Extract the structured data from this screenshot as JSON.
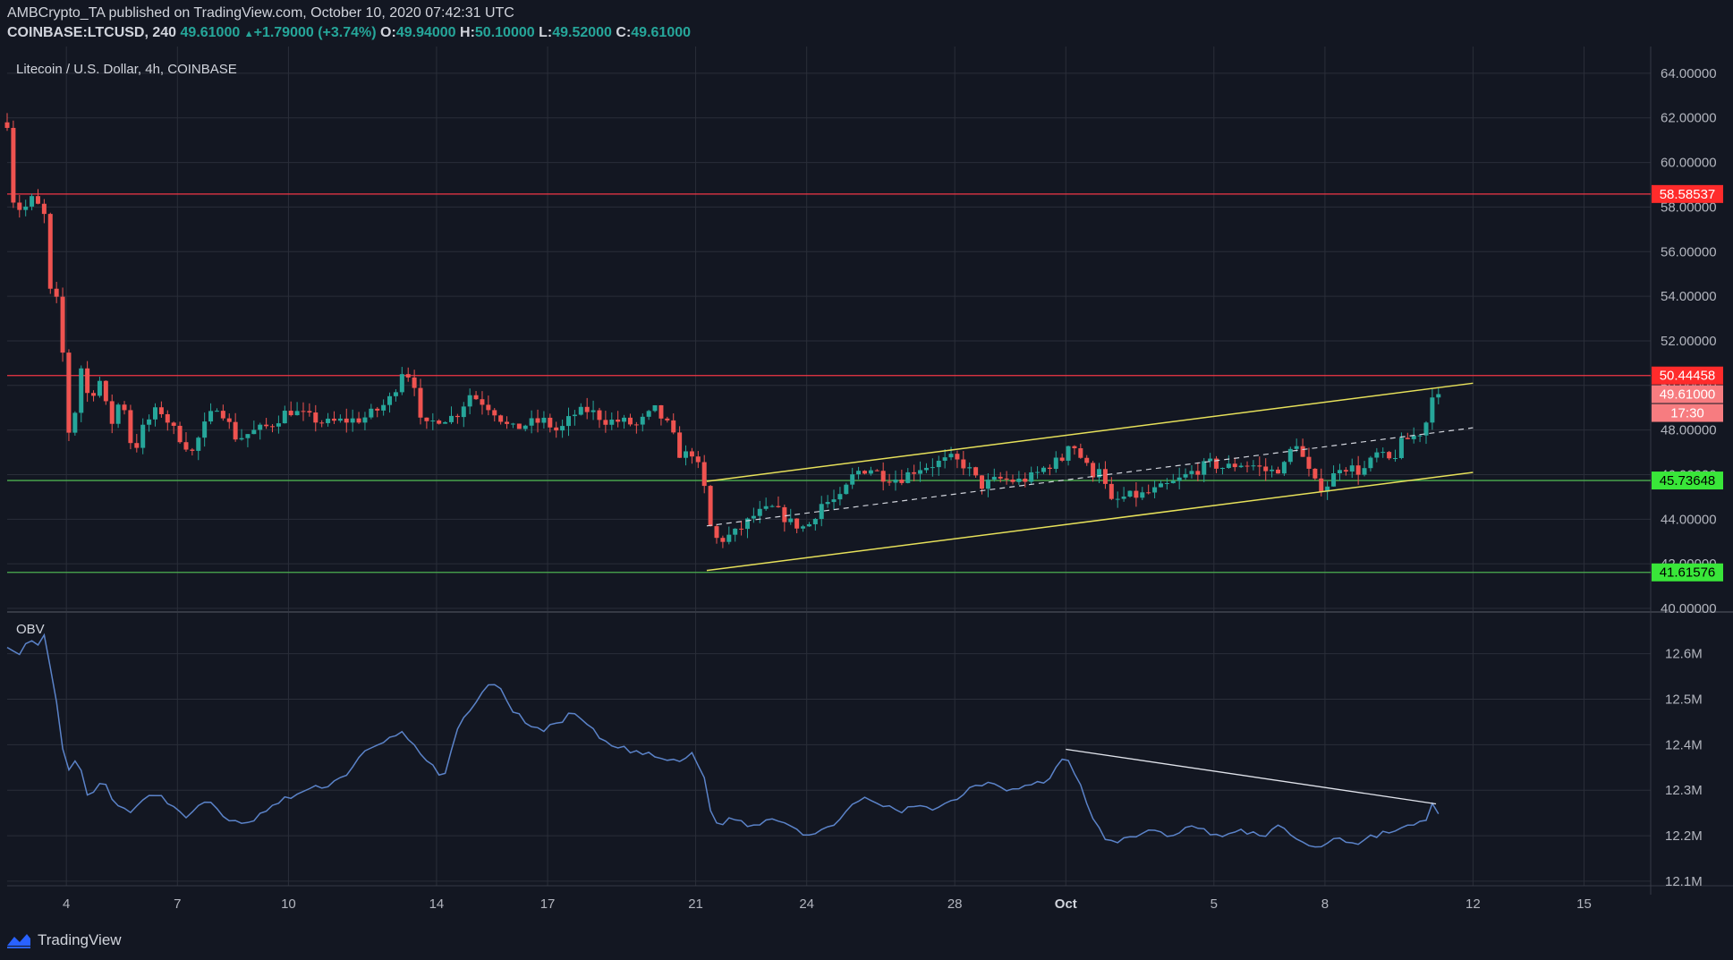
{
  "header": {
    "publisher": "AMBCrypto_TA",
    "published_text": "published on TradingView.com, October 10, 2020 07:42:31 UTC",
    "symbol": "COINBASE:LTCUSD, 240",
    "last": "49.61000",
    "change": "+1.79000 (+3.74%)",
    "o_label": "O:",
    "o_value": "49.94000",
    "h_label": "H:",
    "h_value": "50.10000",
    "l_label": "L:",
    "l_value": "49.52000",
    "c_label": "C:",
    "c_value": "49.61000"
  },
  "pane_title": "Litecoin / U.S. Dollar, 4h, COINBASE",
  "footer": {
    "brand": "TradingView"
  },
  "colors": {
    "bg": "#131722",
    "up": "#26a69a",
    "down": "#ef5350",
    "grid": "#2a2e39",
    "resistance": "#f23645",
    "support": "#4caf50",
    "channel": "#e6e05a",
    "obv": "#5b83c9",
    "text": "#b2b5be",
    "trendline": "#e0e3eb"
  },
  "chart_data": [
    {
      "type": "candlestick",
      "title": "Litecoin / U.S. Dollar, 4h, COINBASE",
      "ylim": [
        39.8,
        65.2
      ],
      "y_ticks": [
        "40.00000",
        "42.00000",
        "44.00000",
        "46.00000",
        "48.00000",
        "50.00000",
        "52.00000",
        "54.00000",
        "56.00000",
        "58.00000",
        "60.00000",
        "62.00000",
        "64.00000"
      ],
      "x_ticks": [
        "4",
        "7",
        "10",
        "14",
        "17",
        "21",
        "24",
        "28",
        "Oct",
        "5",
        "8",
        "12",
        "15"
      ],
      "x_tick_days": [
        4,
        7,
        10,
        14,
        17,
        21,
        24,
        28,
        31,
        35,
        38,
        42,
        45
      ],
      "x_range_days": [
        2.4,
        46.8
      ],
      "anchors": [
        {
          "d": 2.4,
          "p": 61.8
        },
        {
          "d": 2.5,
          "p": 58.5
        },
        {
          "d": 2.8,
          "p": 57.8
        },
        {
          "d": 3.1,
          "p": 58.4
        },
        {
          "d": 3.4,
          "p": 57.6
        },
        {
          "d": 3.6,
          "p": 53.5
        },
        {
          "d": 3.8,
          "p": 53.9
        },
        {
          "d": 3.95,
          "p": 50.2
        },
        {
          "d": 4.1,
          "p": 47.3
        },
        {
          "d": 4.4,
          "p": 50.8
        },
        {
          "d": 4.6,
          "p": 49.4
        },
        {
          "d": 4.9,
          "p": 50.2
        },
        {
          "d": 5.2,
          "p": 48.2
        },
        {
          "d": 5.5,
          "p": 49.6
        },
        {
          "d": 5.8,
          "p": 46.9
        },
        {
          "d": 6.1,
          "p": 48.2
        },
        {
          "d": 6.5,
          "p": 49.0
        },
        {
          "d": 6.9,
          "p": 48.0
        },
        {
          "d": 7.4,
          "p": 47.0
        },
        {
          "d": 7.7,
          "p": 48.1
        },
        {
          "d": 8.1,
          "p": 49.2
        },
        {
          "d": 8.6,
          "p": 47.6
        },
        {
          "d": 9.0,
          "p": 47.9
        },
        {
          "d": 9.5,
          "p": 48.2
        },
        {
          "d": 10.0,
          "p": 48.9
        },
        {
          "d": 10.5,
          "p": 48.6
        },
        {
          "d": 11.0,
          "p": 48.3
        },
        {
          "d": 11.4,
          "p": 48.4
        },
        {
          "d": 12.0,
          "p": 48.5
        },
        {
          "d": 12.5,
          "p": 49.0
        },
        {
          "d": 12.8,
          "p": 49.5
        },
        {
          "d": 13.1,
          "p": 50.8
        },
        {
          "d": 13.4,
          "p": 50.1
        },
        {
          "d": 13.6,
          "p": 48.0
        },
        {
          "d": 14.0,
          "p": 48.5
        },
        {
          "d": 14.5,
          "p": 48.6
        },
        {
          "d": 14.9,
          "p": 49.6
        },
        {
          "d": 15.3,
          "p": 49.2
        },
        {
          "d": 15.6,
          "p": 48.8
        },
        {
          "d": 16.0,
          "p": 48.0
        },
        {
          "d": 16.5,
          "p": 48.3
        },
        {
          "d": 16.9,
          "p": 48.4
        },
        {
          "d": 17.3,
          "p": 47.9
        },
        {
          "d": 17.7,
          "p": 48.7
        },
        {
          "d": 18.1,
          "p": 48.9
        },
        {
          "d": 18.6,
          "p": 48.4
        },
        {
          "d": 19.0,
          "p": 48.4
        },
        {
          "d": 19.4,
          "p": 48.2
        },
        {
          "d": 19.9,
          "p": 48.9
        },
        {
          "d": 20.3,
          "p": 48.1
        },
        {
          "d": 20.6,
          "p": 46.8
        },
        {
          "d": 20.9,
          "p": 47.0
        },
        {
          "d": 21.2,
          "p": 45.8
        },
        {
          "d": 21.35,
          "p": 43.8
        },
        {
          "d": 21.6,
          "p": 43.0
        },
        {
          "d": 22.1,
          "p": 43.4
        },
        {
          "d": 22.6,
          "p": 44.2
        },
        {
          "d": 23.1,
          "p": 44.5
        },
        {
          "d": 23.6,
          "p": 43.8
        },
        {
          "d": 24.0,
          "p": 43.6
        },
        {
          "d": 24.4,
          "p": 44.7
        },
        {
          "d": 24.9,
          "p": 44.9
        },
        {
          "d": 25.3,
          "p": 46.1
        },
        {
          "d": 25.7,
          "p": 46.3
        },
        {
          "d": 26.1,
          "p": 45.9
        },
        {
          "d": 26.5,
          "p": 45.8
        },
        {
          "d": 27.0,
          "p": 46.3
        },
        {
          "d": 27.5,
          "p": 46.5
        },
        {
          "d": 27.9,
          "p": 46.7
        },
        {
          "d": 28.3,
          "p": 46.4
        },
        {
          "d": 28.7,
          "p": 45.5
        },
        {
          "d": 29.2,
          "p": 45.8
        },
        {
          "d": 29.7,
          "p": 45.7
        },
        {
          "d": 30.1,
          "p": 45.9
        },
        {
          "d": 30.5,
          "p": 46.4
        },
        {
          "d": 30.9,
          "p": 46.7
        },
        {
          "d": 31.1,
          "p": 47.6
        },
        {
          "d": 31.4,
          "p": 46.8
        },
        {
          "d": 31.7,
          "p": 46.0
        },
        {
          "d": 31.9,
          "p": 46.4
        },
        {
          "d": 32.2,
          "p": 44.7
        },
        {
          "d": 32.6,
          "p": 45.0
        },
        {
          "d": 33.1,
          "p": 45.1
        },
        {
          "d": 33.6,
          "p": 45.4
        },
        {
          "d": 34.0,
          "p": 45.7
        },
        {
          "d": 34.4,
          "p": 46.1
        },
        {
          "d": 34.9,
          "p": 46.5
        },
        {
          "d": 35.3,
          "p": 46.3
        },
        {
          "d": 35.7,
          "p": 46.5
        },
        {
          "d": 36.1,
          "p": 46.4
        },
        {
          "d": 36.5,
          "p": 46.1
        },
        {
          "d": 36.9,
          "p": 46.4
        },
        {
          "d": 37.2,
          "p": 47.6
        },
        {
          "d": 37.5,
          "p": 46.3
        },
        {
          "d": 37.8,
          "p": 45.4
        },
        {
          "d": 38.1,
          "p": 45.6
        },
        {
          "d": 38.4,
          "p": 46.4
        },
        {
          "d": 38.7,
          "p": 46.3
        },
        {
          "d": 39.0,
          "p": 46.1
        },
        {
          "d": 39.4,
          "p": 46.9
        },
        {
          "d": 39.8,
          "p": 46.6
        },
        {
          "d": 40.1,
          "p": 47.5
        },
        {
          "d": 40.5,
          "p": 47.8
        },
        {
          "d": 40.7,
          "p": 48.1
        },
        {
          "d": 40.9,
          "p": 49.7
        },
        {
          "d": 41.1,
          "p": 49.61
        }
      ],
      "horizontal_levels": [
        {
          "value": 58.58537,
          "label": "58.58537",
          "kind": "resistance"
        },
        {
          "value": 50.44458,
          "label": "50.44458",
          "kind": "resistance"
        },
        {
          "value": 45.73648,
          "label": "45.73648",
          "kind": "support"
        },
        {
          "value": 41.61576,
          "label": "41.61576",
          "kind": "support"
        }
      ],
      "last_price_label": "49.61000",
      "countdown_label": "17:30",
      "channel": {
        "upper": [
          {
            "d": 21.3,
            "p": 45.7
          },
          {
            "d": 42.0,
            "p": 50.1
          }
        ],
        "lower": [
          {
            "d": 21.3,
            "p": 41.7
          },
          {
            "d": 42.0,
            "p": 46.1
          }
        ],
        "middle": [
          {
            "d": 21.3,
            "p": 43.7
          },
          {
            "d": 42.0,
            "p": 48.1
          }
        ]
      }
    },
    {
      "type": "line",
      "title": "OBV",
      "ylim": [
        12.09,
        12.68
      ],
      "y_ticks": [
        "12.1M",
        "12.2M",
        "12.3M",
        "12.4M",
        "12.5M",
        "12.6M"
      ],
      "anchors": [
        {
          "d": 2.4,
          "v": 12.62
        },
        {
          "d": 2.7,
          "v": 12.59
        },
        {
          "d": 3.0,
          "v": 12.63
        },
        {
          "d": 3.2,
          "v": 12.61
        },
        {
          "d": 3.4,
          "v": 12.64
        },
        {
          "d": 3.6,
          "v": 12.55
        },
        {
          "d": 3.8,
          "v": 12.46
        },
        {
          "d": 4.0,
          "v": 12.33
        },
        {
          "d": 4.3,
          "v": 12.37
        },
        {
          "d": 4.6,
          "v": 12.28
        },
        {
          "d": 5.0,
          "v": 12.32
        },
        {
          "d": 5.4,
          "v": 12.26
        },
        {
          "d": 5.8,
          "v": 12.25
        },
        {
          "d": 6.3,
          "v": 12.3
        },
        {
          "d": 6.8,
          "v": 12.27
        },
        {
          "d": 7.3,
          "v": 12.24
        },
        {
          "d": 7.8,
          "v": 12.28
        },
        {
          "d": 8.3,
          "v": 12.24
        },
        {
          "d": 8.8,
          "v": 12.22
        },
        {
          "d": 9.3,
          "v": 12.25
        },
        {
          "d": 9.9,
          "v": 12.28
        },
        {
          "d": 10.5,
          "v": 12.3
        },
        {
          "d": 11.0,
          "v": 12.31
        },
        {
          "d": 11.5,
          "v": 12.33
        },
        {
          "d": 12.0,
          "v": 12.38
        },
        {
          "d": 12.5,
          "v": 12.4
        },
        {
          "d": 13.0,
          "v": 12.43
        },
        {
          "d": 13.4,
          "v": 12.4
        },
        {
          "d": 13.8,
          "v": 12.36
        },
        {
          "d": 14.2,
          "v": 12.32
        },
        {
          "d": 14.5,
          "v": 12.42
        },
        {
          "d": 14.9,
          "v": 12.48
        },
        {
          "d": 15.3,
          "v": 12.52
        },
        {
          "d": 15.6,
          "v": 12.54
        },
        {
          "d": 16.0,
          "v": 12.48
        },
        {
          "d": 16.4,
          "v": 12.45
        },
        {
          "d": 16.9,
          "v": 12.43
        },
        {
          "d": 17.3,
          "v": 12.45
        },
        {
          "d": 17.7,
          "v": 12.47
        },
        {
          "d": 18.1,
          "v": 12.44
        },
        {
          "d": 18.6,
          "v": 12.4
        },
        {
          "d": 19.1,
          "v": 12.39
        },
        {
          "d": 19.6,
          "v": 12.38
        },
        {
          "d": 20.1,
          "v": 12.37
        },
        {
          "d": 20.5,
          "v": 12.36
        },
        {
          "d": 20.9,
          "v": 12.38
        },
        {
          "d": 21.2,
          "v": 12.34
        },
        {
          "d": 21.5,
          "v": 12.22
        },
        {
          "d": 22.0,
          "v": 12.24
        },
        {
          "d": 22.5,
          "v": 12.22
        },
        {
          "d": 23.0,
          "v": 12.24
        },
        {
          "d": 23.5,
          "v": 12.23
        },
        {
          "d": 24.0,
          "v": 12.2
        },
        {
          "d": 24.5,
          "v": 12.21
        },
        {
          "d": 25.0,
          "v": 12.25
        },
        {
          "d": 25.5,
          "v": 12.28
        },
        {
          "d": 26.0,
          "v": 12.27
        },
        {
          "d": 26.5,
          "v": 12.25
        },
        {
          "d": 27.0,
          "v": 12.27
        },
        {
          "d": 27.5,
          "v": 12.26
        },
        {
          "d": 28.0,
          "v": 12.28
        },
        {
          "d": 28.5,
          "v": 12.31
        },
        {
          "d": 29.0,
          "v": 12.32
        },
        {
          "d": 29.5,
          "v": 12.3
        },
        {
          "d": 30.0,
          "v": 12.31
        },
        {
          "d": 30.5,
          "v": 12.32
        },
        {
          "d": 31.0,
          "v": 12.38
        },
        {
          "d": 31.3,
          "v": 12.33
        },
        {
          "d": 31.6,
          "v": 12.26
        },
        {
          "d": 32.0,
          "v": 12.2
        },
        {
          "d": 32.3,
          "v": 12.18
        },
        {
          "d": 32.8,
          "v": 12.2
        },
        {
          "d": 33.3,
          "v": 12.21
        },
        {
          "d": 33.8,
          "v": 12.2
        },
        {
          "d": 34.3,
          "v": 12.22
        },
        {
          "d": 34.8,
          "v": 12.21
        },
        {
          "d": 35.3,
          "v": 12.2
        },
        {
          "d": 35.8,
          "v": 12.21
        },
        {
          "d": 36.3,
          "v": 12.2
        },
        {
          "d": 36.8,
          "v": 12.22
        },
        {
          "d": 37.3,
          "v": 12.19
        },
        {
          "d": 37.8,
          "v": 12.17
        },
        {
          "d": 38.3,
          "v": 12.2
        },
        {
          "d": 38.8,
          "v": 12.18
        },
        {
          "d": 39.3,
          "v": 12.2
        },
        {
          "d": 39.8,
          "v": 12.21
        },
        {
          "d": 40.3,
          "v": 12.22
        },
        {
          "d": 40.7,
          "v": 12.23
        },
        {
          "d": 40.9,
          "v": 12.27
        },
        {
          "d": 41.1,
          "v": 12.25
        }
      ],
      "trendline": [
        {
          "d": 31.0,
          "v": 12.39
        },
        {
          "d": 41.0,
          "v": 12.27
        }
      ]
    }
  ]
}
